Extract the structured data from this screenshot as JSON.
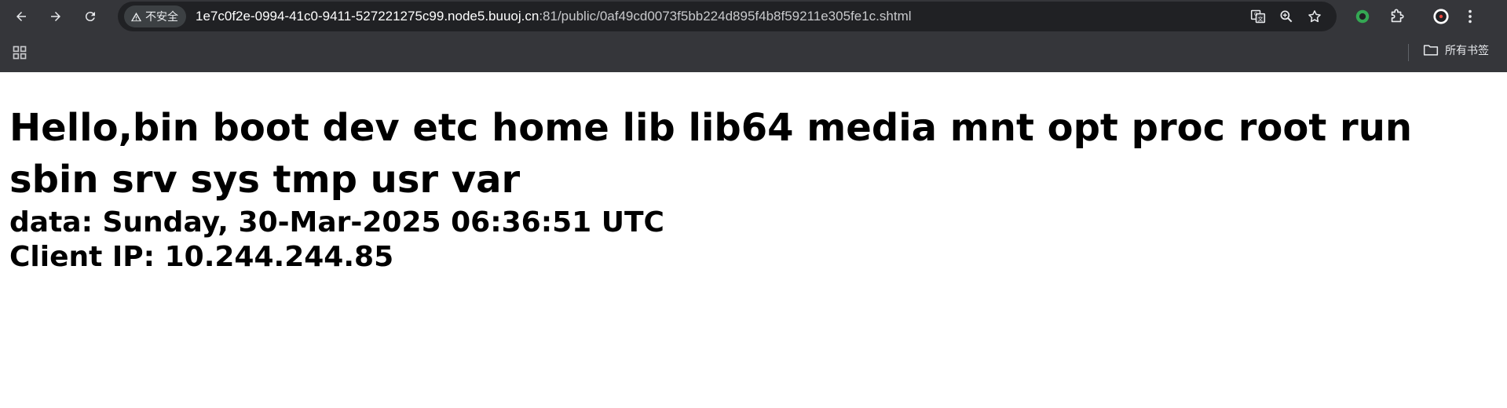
{
  "browser": {
    "security_label": "不安全",
    "url_host": "1e7c0f2e-0994-41c0-9411-527221275c99.node5.buuoj.cn",
    "url_rest": ":81/public/0af49cd0073f5bb224d895f4b8f59211e305fe1c.shtml",
    "bookmarks_label": "所有书签"
  },
  "page": {
    "greeting": "Hello,bin boot dev etc home lib lib64 media mnt opt proc root run sbin srv sys tmp usr var",
    "date_line": "data: Sunday, 30-Mar-2025 06:36:51 UTC",
    "ip_line": "Client IP: 10.244.244.85"
  },
  "colors": {
    "chrome_bg": "#35363a",
    "omnibox_bg": "#202124",
    "page_bg": "#ffffff",
    "text": "#000000"
  },
  "icons": [
    "back-arrow-icon",
    "forward-arrow-icon",
    "reload-icon",
    "warning-icon",
    "translate-icon",
    "zoom-icon",
    "star-icon",
    "extension-green-circle-icon",
    "puzzle-icon",
    "profile-icon",
    "menu-kebab-icon",
    "apps-grid-icon",
    "folder-icon"
  ]
}
